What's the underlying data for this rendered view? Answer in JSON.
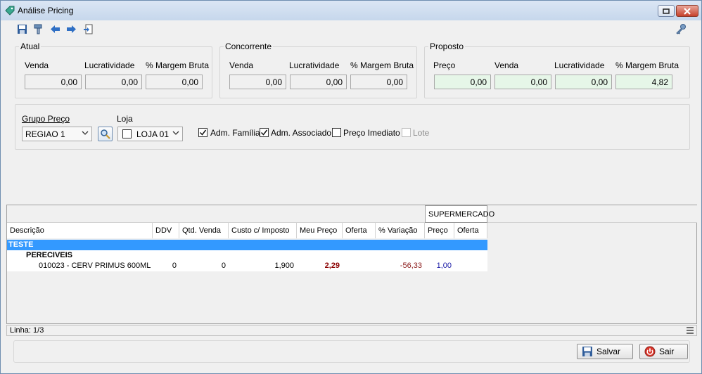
{
  "window": {
    "title": "Análise Pricing"
  },
  "atual": {
    "legend": "Atual",
    "venda_label": "Venda",
    "venda": "0,00",
    "lucratividade_label": "Lucratividade",
    "lucratividade": "0,00",
    "margem_label": "% Margem Bruta",
    "margem": "0,00"
  },
  "concorrente": {
    "legend": "Concorrente",
    "venda_label": "Venda",
    "venda": "0,00",
    "lucratividade_label": "Lucratividade",
    "lucratividade": "0,00",
    "margem_label": "% Margem Bruta",
    "margem": "0,00"
  },
  "proposto": {
    "legend": "Proposto",
    "preco_label": "Preço",
    "preco": "0,00",
    "venda_label": "Venda",
    "venda": "0,00",
    "lucratividade_label": "Lucratividade",
    "lucratividade": "0,00",
    "margem_label": "% Margem Bruta",
    "margem": "4,82"
  },
  "filters": {
    "grupo_label": "Grupo Preço",
    "grupo_value": "REGIAO 1",
    "loja_label": "Loja",
    "loja_value": "LOJA 01",
    "adm_familia": "Adm. Família",
    "adm_associado": "Adm. Associado",
    "preco_imediato": "Preço Imediato",
    "lote": "Lote"
  },
  "grid": {
    "group_header": "SUPERMERCADO",
    "columns": [
      "Descrição",
      "DDV",
      "Qtd. Venda",
      "Custo c/ Imposto",
      "Meu Preço",
      "Oferta",
      "% Variação",
      "Preço",
      "Oferta"
    ],
    "group_row": "TESTE",
    "subgroup_row": "PERECIVEIS",
    "item": {
      "descricao": "010023 - CERV PRIMUS 600ML",
      "ddv": "0",
      "qtd_venda": "0",
      "custo": "1,900",
      "meu_preco": "2,29",
      "oferta": "",
      "variacao": "-56,33",
      "preco_super": "1,00",
      "oferta_super": ""
    }
  },
  "status": {
    "linha": "Linha: 1/3"
  },
  "buttons": {
    "salvar": "Salvar",
    "sair": "Sair"
  },
  "colors": {
    "accent_row": "#3399ff",
    "price_red": "#8b0000",
    "variation": "#8b1a1a",
    "blue": "#1a1aa6",
    "green_field": "#e6f6e8"
  }
}
